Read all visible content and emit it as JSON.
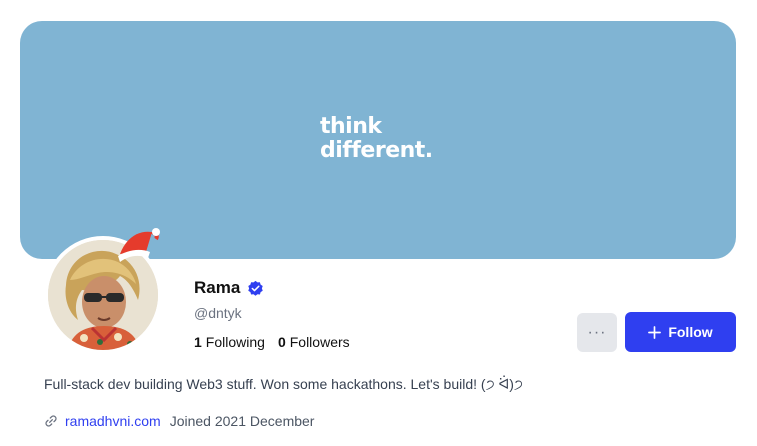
{
  "cover": {
    "text": "think\ndifferent.",
    "color": "#80b4d3"
  },
  "profile": {
    "name": "Rama",
    "handle": "@dntyk",
    "verified_icon": "verified-badge-icon",
    "avatar_icon": "avatar-illustration",
    "hat_icon": "santa-hat-icon"
  },
  "stats": {
    "following_count": "1",
    "following_label": "Following",
    "followers_count": "0",
    "followers_label": "Followers"
  },
  "actions": {
    "more_label": "···",
    "follow_label": "Follow",
    "follow_color": "#2f3ff0"
  },
  "bio": "Full-stack dev building Web3 stuff. Won some hackathons. Let's build! (੭ ᐛ)੭",
  "meta": {
    "website": "ramadhvni.com",
    "joined": "Joined 2021 December"
  }
}
